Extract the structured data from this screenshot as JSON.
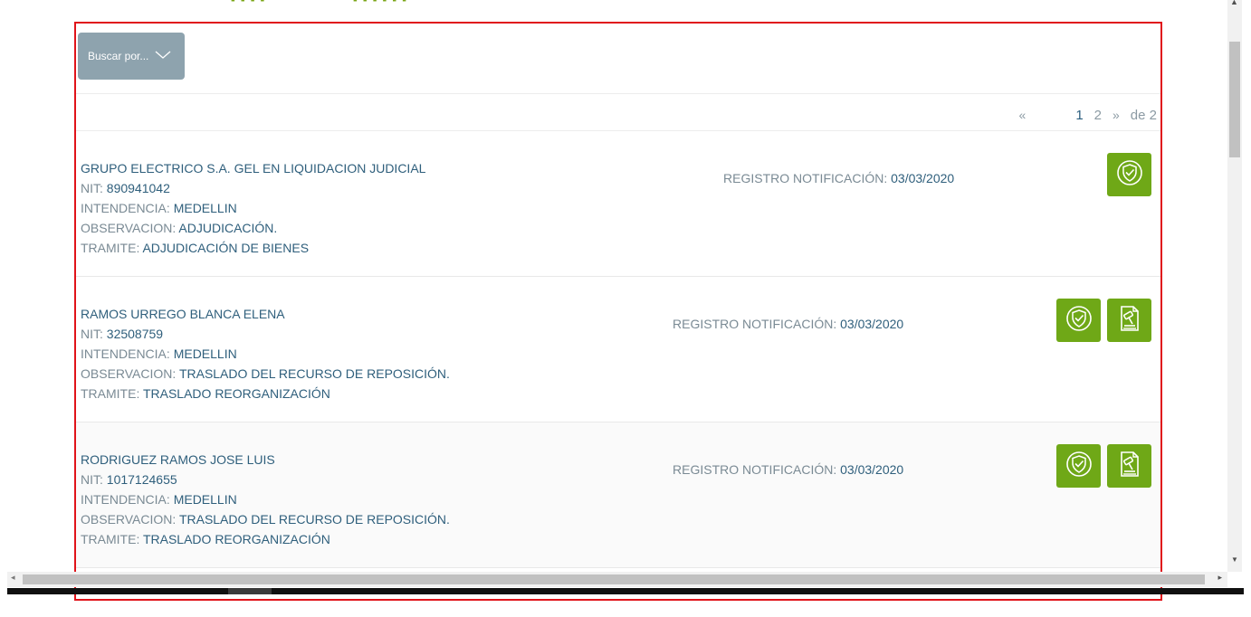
{
  "search": {
    "label": "Buscar por..."
  },
  "pagination": {
    "prev": "«",
    "pages": [
      "1",
      "2"
    ],
    "next": "»",
    "total": "de 2"
  },
  "labels": {
    "nit": "NIT: ",
    "intendencia": "INTENDENCIA: ",
    "observacion": "OBSERVACION: ",
    "tramite": "TRAMITE: ",
    "registro": "REGISTRO NOTIFICACIÓN: "
  },
  "results": [
    {
      "name": "GRUPO ELECTRICO S.A. GEL EN LIQUIDACION JUDICIAL",
      "nit": "890941042",
      "intendencia": "MEDELLIN",
      "observacion": "ADJUDICACIÓN.",
      "tramite": "ADJUDICACIÓN DE BIENES",
      "registro": "03/03/2020",
      "actions": [
        "shield-check-icon"
      ]
    },
    {
      "name": "RAMOS URREGO BLANCA ELENA",
      "nit": "32508759",
      "intendencia": "MEDELLIN",
      "observacion": "TRASLADO DEL RECURSO DE REPOSICIÓN.",
      "tramite": "TRASLADO REORGANIZACIÓN",
      "registro": "03/03/2020",
      "actions": [
        "shield-check-icon",
        "gavel-document-icon"
      ]
    },
    {
      "name": "RODRIGUEZ RAMOS JOSE LUIS",
      "nit": "1017124655",
      "intendencia": "MEDELLIN",
      "observacion": "TRASLADO DEL RECURSO DE REPOSICIÓN.",
      "tramite": "TRASLADO REORGANIZACIÓN",
      "registro": "03/03/2020",
      "actions": [
        "shield-check-icon",
        "gavel-document-icon"
      ]
    }
  ],
  "colors": {
    "accent_green": "#6fa817",
    "panel_border": "#e0131a",
    "search_button": "#8ea3ae",
    "value_text": "#2f5f7c"
  }
}
